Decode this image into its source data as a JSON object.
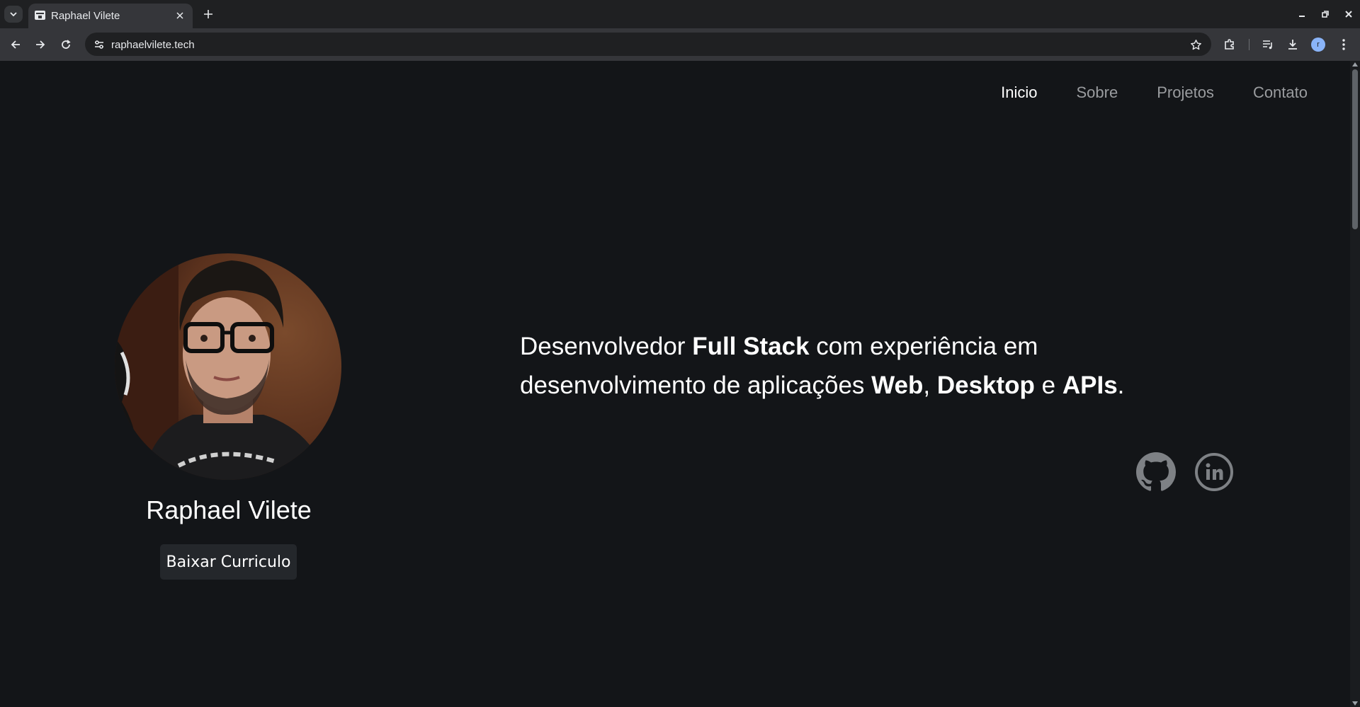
{
  "browser": {
    "tab_title": "Raphael Vilete",
    "url": "raphaelvilete.tech",
    "profile_initial": "r"
  },
  "nav": {
    "items": [
      {
        "label": "Inicio",
        "active": true
      },
      {
        "label": "Sobre",
        "active": false
      },
      {
        "label": "Projetos",
        "active": false
      },
      {
        "label": "Contato",
        "active": false
      }
    ]
  },
  "profile": {
    "name": "Raphael Vilete",
    "cv_button": "Baixar Curriculo"
  },
  "intro": {
    "t1": "Desenvolvedor ",
    "b1": "Full Stack",
    "t2": " com experiência em desenvolvimento de aplicações ",
    "b2": "Web",
    "t3": ", ",
    "b3": "Desktop",
    "t4": " e ",
    "b4": "APIs",
    "t5": "."
  },
  "social": {
    "icons": [
      "github-icon",
      "linkedin-icon"
    ]
  },
  "colors": {
    "page_bg": "#131518",
    "accent_text": "#ffffff",
    "muted_text": "#9a9c9f",
    "button_bg": "#24272b"
  }
}
